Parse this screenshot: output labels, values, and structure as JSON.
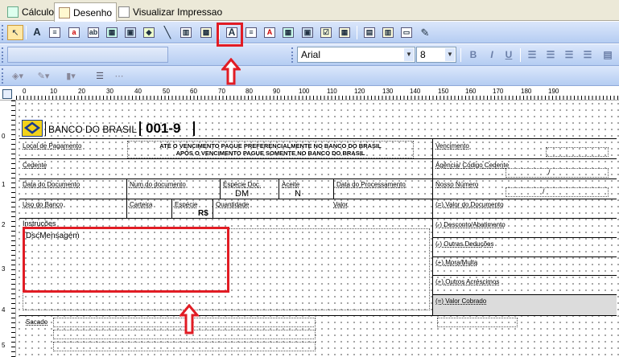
{
  "tabs": [
    {
      "label": "Cálculo",
      "icon": "calc-icon"
    },
    {
      "label": "Desenho",
      "icon": "design-icon"
    },
    {
      "label": "Visualizar Impressao",
      "icon": "print-preview-icon"
    }
  ],
  "format_toolbar": {
    "font_family": "Arial",
    "font_size": "8",
    "bold": "B",
    "italic": "I",
    "underline": "U"
  },
  "ruler": {
    "h_labels": [
      "0",
      "10",
      "20",
      "30",
      "40",
      "50",
      "60",
      "70",
      "80",
      "90",
      "100",
      "110",
      "120",
      "130",
      "140",
      "150",
      "160",
      "170",
      "180",
      "190"
    ],
    "v_labels": [
      "0",
      "1",
      "2",
      "3",
      "4",
      "5"
    ]
  },
  "boleto": {
    "bank_name": "BANCO DO BRASIL",
    "bank_code": "001-9",
    "labels": {
      "local_pagamento": "Local de Pagamento",
      "vencimento": "Vencimento",
      "cedente": "Cedente",
      "agencia": "Agência/ Código Cedente",
      "data_documento": "Data do Documento",
      "num_documento": "Num.do documento",
      "especie_doc": "Espécie Doc.",
      "aceite": "Aceite",
      "data_processamento": "Data do Processamento",
      "nosso_numero": "Nosso Número",
      "uso_banco": "Uso do Banco",
      "carteira": "Carteira",
      "especie": "Espécie",
      "quantidade": "Quantidade",
      "valor": "Valor",
      "valor_documento": "(=) Valor do Documento",
      "instrucoes": "Instruções",
      "desconto": "(-) Desconto/Abatimento",
      "outras_deducoes": "(-) Outras Deduções",
      "mora_multa": "(+) Mora/Multa",
      "outros_acrescimos": "(+) Outros Acréscimos",
      "valor_cobrado": "(=) Valor Cobrado",
      "sacado": "Sacado"
    },
    "local_pagamento_line1": "ATÉ O VENCIMENTO PAGUE PREFERENCIALMENTE NO BANCO DO BRASIL",
    "local_pagamento_line2": "APÓS O VENCIMENTO PAGUE SOMENTE NO BANCO DO BRASIL",
    "especie_doc_value": "DM",
    "aceite_value": "N",
    "especie_value": "R$",
    "mensagem_field": "DscMensagem",
    "agencia_value": "/",
    "nosso_numero_value": "/"
  },
  "colors": {
    "annotation": "#e11c24",
    "toolbar": "#b5cdf2"
  }
}
